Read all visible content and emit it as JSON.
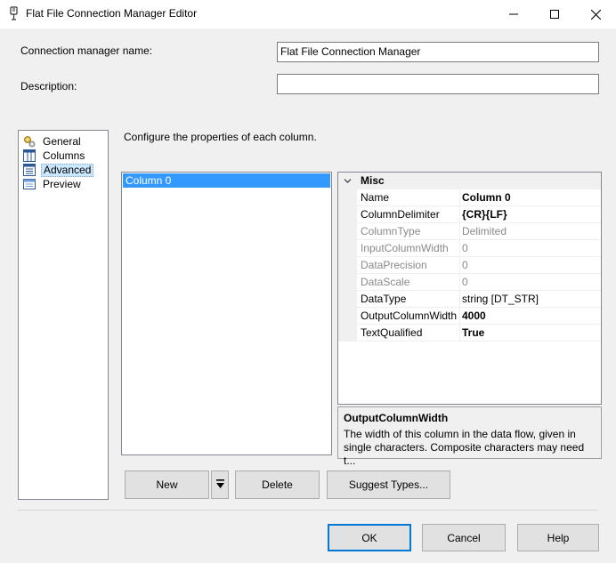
{
  "window": {
    "title": "Flat File Connection Manager Editor"
  },
  "form": {
    "name_label": "Connection manager name:",
    "name_value": "Flat File Connection Manager",
    "description_label": "Description:",
    "description_value": ""
  },
  "nav": {
    "items": [
      {
        "label": "General",
        "icon": "general-icon"
      },
      {
        "label": "Columns",
        "icon": "columns-icon"
      },
      {
        "label": "Advanced",
        "icon": "advanced-icon",
        "selected": true
      },
      {
        "label": "Preview",
        "icon": "preview-icon"
      }
    ]
  },
  "main": {
    "instruction": "Configure the properties of each column.",
    "columns": [
      "Column 0"
    ]
  },
  "properties": {
    "category": "Misc",
    "rows": [
      {
        "name": "Name",
        "value": "Column 0",
        "bold": true,
        "dim": false
      },
      {
        "name": "ColumnDelimiter",
        "value": "{CR}{LF}",
        "bold": true,
        "dim": false
      },
      {
        "name": "ColumnType",
        "value": "Delimited",
        "bold": false,
        "dim": true
      },
      {
        "name": "InputColumnWidth",
        "value": "0",
        "bold": false,
        "dim": true
      },
      {
        "name": "DataPrecision",
        "value": "0",
        "bold": false,
        "dim": true
      },
      {
        "name": "DataScale",
        "value": "0",
        "bold": false,
        "dim": true
      },
      {
        "name": "DataType",
        "value": "string [DT_STR]",
        "bold": false,
        "dim": false
      },
      {
        "name": "OutputColumnWidth",
        "value": "4000",
        "bold": true,
        "dim": false
      },
      {
        "name": "TextQualified",
        "value": "True",
        "bold": true,
        "dim": false
      }
    ]
  },
  "description_pane": {
    "title": "OutputColumnWidth",
    "text": "The width of this column in the data flow, given in single characters. Composite characters may need t..."
  },
  "actions": {
    "new": "New",
    "delete": "Delete",
    "suggest": "Suggest Types..."
  },
  "footer": {
    "ok": "OK",
    "cancel": "Cancel",
    "help": "Help"
  },
  "colors": {
    "selection": "#3399ff",
    "nav_selection": "#cce8ff",
    "default_button_border": "#0078d7"
  }
}
